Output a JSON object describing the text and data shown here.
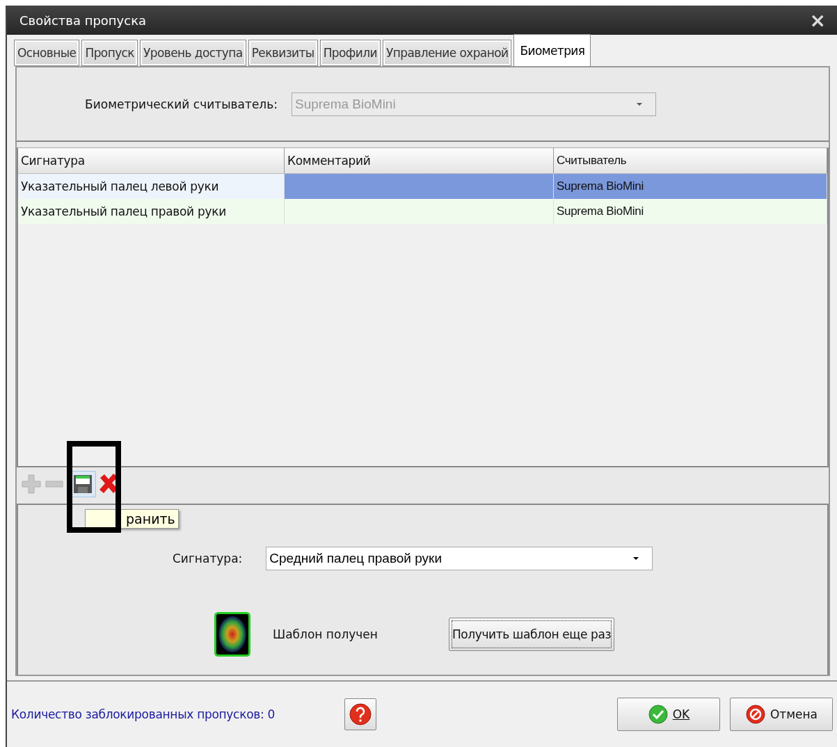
{
  "window": {
    "title": "Свойства пропуска",
    "close": "×"
  },
  "tabs": [
    {
      "label": "Основные",
      "selected": false
    },
    {
      "label": "Пропуск",
      "selected": false
    },
    {
      "label": "Уровень доступа",
      "selected": false
    },
    {
      "label": "Реквизиты",
      "selected": false
    },
    {
      "label": "Профили",
      "selected": false
    },
    {
      "label": "Управление охраной",
      "selected": false
    },
    {
      "label": "Биометрия",
      "selected": true
    }
  ],
  "reader": {
    "label": "Биометрический считыватель:",
    "value": "Suprema BioMini",
    "disabled": true
  },
  "table": {
    "columns": [
      "Сигнатура",
      "Комментарий",
      "Считыватель"
    ],
    "rows": [
      {
        "cells": [
          "Указательный палец левой руки",
          "",
          "Suprema BioMini"
        ],
        "selected": true
      },
      {
        "cells": [
          "Указательный палец правой руки",
          "",
          "Suprema BioMini"
        ],
        "selected": false
      }
    ]
  },
  "toolbar": {
    "tooltip": "ранить"
  },
  "signature": {
    "label": "Сигнатура:",
    "value": "Средний палец правой руки"
  },
  "template": {
    "status": "Шаблон получен",
    "button": "Получить шаблон еще раз"
  },
  "footer": {
    "blocked": "Количество заблокированных пропусков: 0",
    "ok": "OK",
    "cancel": "Отмена"
  }
}
